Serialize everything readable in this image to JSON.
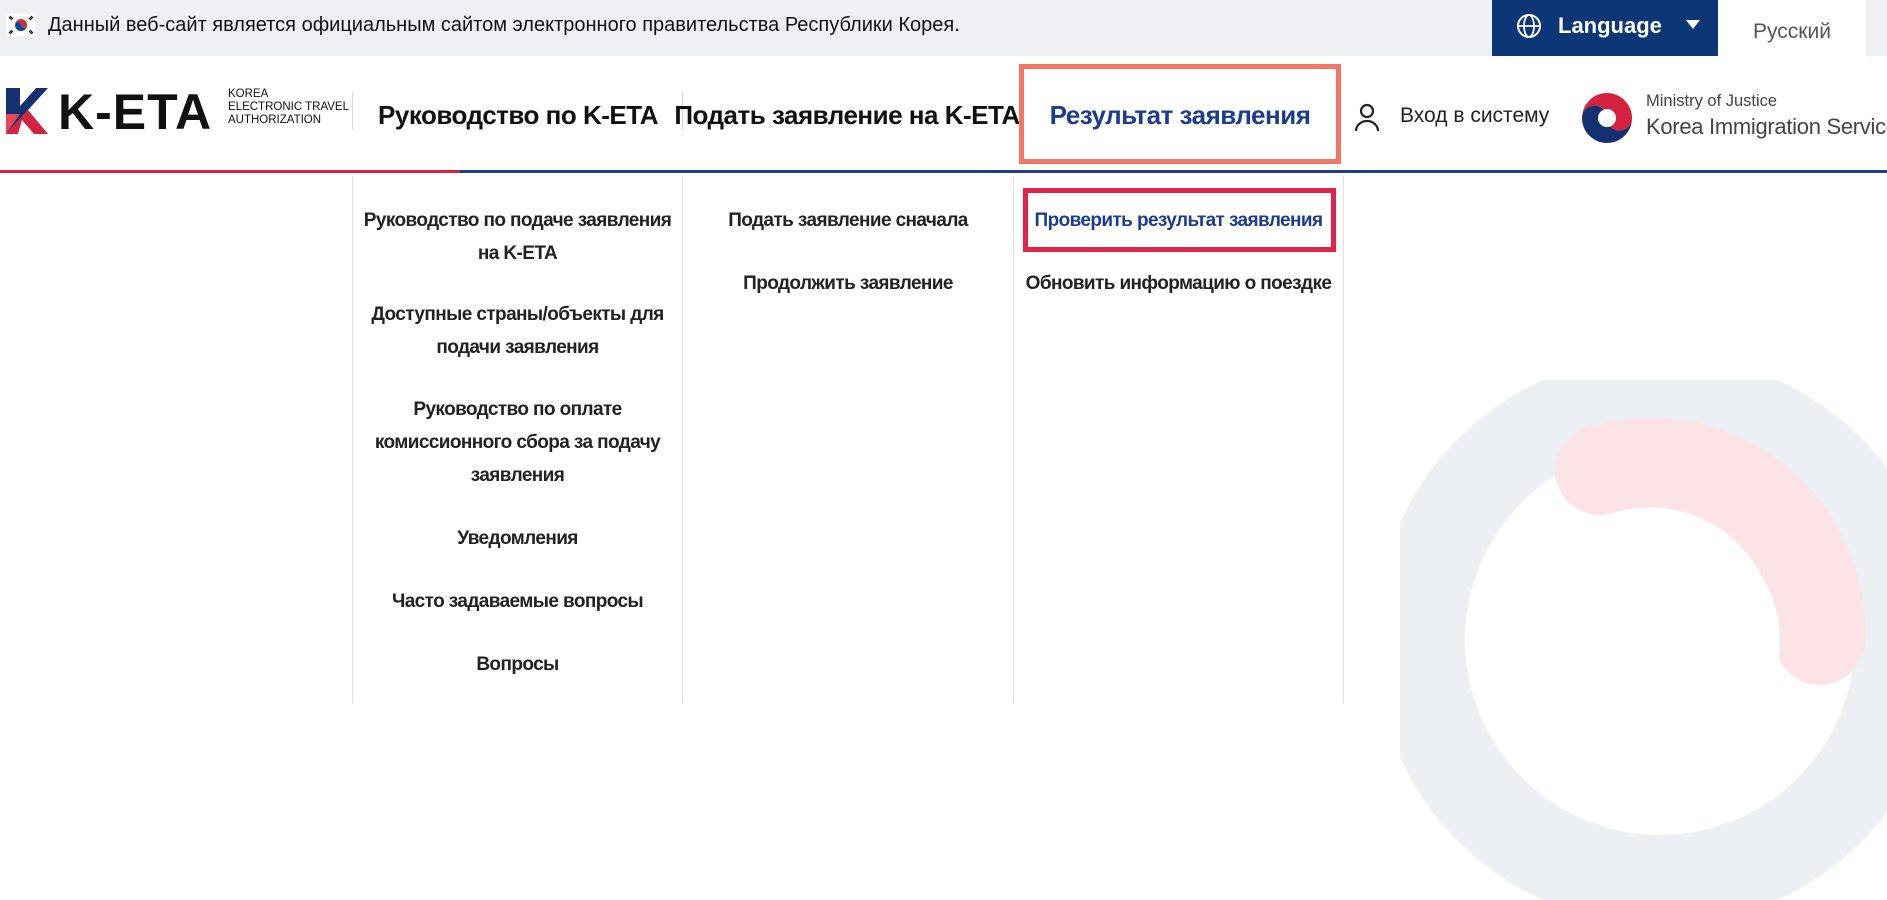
{
  "topbar": {
    "notice": "Данный веб-сайт является официальным сайтом электронного правительства Республики Корея.",
    "language_label": "Language",
    "current_language": "Русский"
  },
  "logo": {
    "brand": "K-ETA",
    "sub_line1": "KOREA",
    "sub_line2": "ELECTRONIC TRAVEL",
    "sub_line3": "AUTHORIZATION"
  },
  "nav": {
    "items": [
      {
        "label": "Руководство по K-ETA"
      },
      {
        "label": "Подать заявление на K-ETA"
      },
      {
        "label": "Результат заявления"
      }
    ],
    "login_label": "Вход в систему"
  },
  "ministry": {
    "line1": "Ministry of Justice",
    "line2": "Korea Immigration Service"
  },
  "dropdown": {
    "col1": [
      {
        "label": "Руководство по подаче заявления на K-ETA"
      },
      {
        "label": "Доступные страны/объекты для подачи заявления"
      },
      {
        "label": "Руководство по оплате комиссионного сбора за подачу заявления"
      },
      {
        "label": "Уведомления"
      },
      {
        "label": "Часто задаваемые вопросы"
      },
      {
        "label": "Вопросы"
      }
    ],
    "col2": [
      {
        "label": "Подать заявление сначала"
      },
      {
        "label": "Продолжить заявление"
      }
    ],
    "col3": [
      {
        "label": "Проверить результат заявления"
      },
      {
        "label": "Обновить информацию о поездке"
      }
    ]
  },
  "colors": {
    "accent_blue": "#1c3d8f",
    "language_bg": "#0d3677",
    "highlight_nav": "#f47664",
    "highlight_sub": "#e0234b",
    "header_line_red": "#d5233f",
    "header_line_blue": "#1f3f86"
  }
}
